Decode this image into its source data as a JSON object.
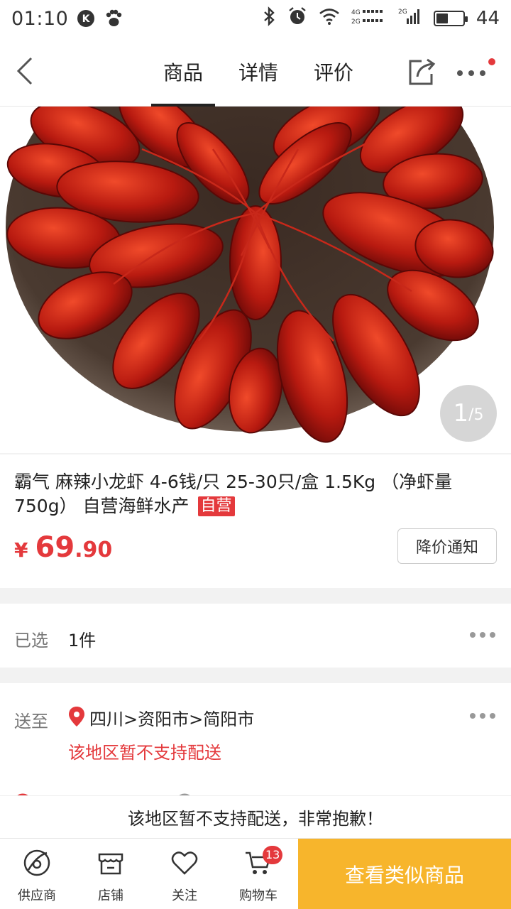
{
  "status_bar": {
    "time": "01:10",
    "battery": "44",
    "battery_level": 0.44,
    "icons": [
      "k-icon",
      "paw-icon",
      "bluetooth-icon",
      "alarm-icon",
      "wifi-icon",
      "signal-4g-icon",
      "signal-2g-icon",
      "battery-icon"
    ]
  },
  "nav": {
    "tabs": [
      {
        "label": "商品",
        "active": true
      },
      {
        "label": "详情",
        "active": false
      },
      {
        "label": "评价",
        "active": false
      }
    ]
  },
  "gallery": {
    "current": "1",
    "separator": "/",
    "total": "5"
  },
  "product": {
    "title": "霸气 麻辣小龙虾 4-6钱/只 25-30只/盒 1.5Kg （净虾量750g） 自营海鲜水产",
    "badge": "自营",
    "price_currency": "¥",
    "price_int": "69",
    "price_dec": ".90",
    "notify_label": "降价通知"
  },
  "selected": {
    "label": "已选",
    "value": "1件"
  },
  "delivery": {
    "label": "送至",
    "location": "四川>资阳市>简阳市",
    "warning": "该地区暂不支持配送"
  },
  "notice": "该地区暂不支持配送，非常抱歉！",
  "bottom_bar": {
    "items": [
      {
        "label": "供应商",
        "icon": "supplier-icon"
      },
      {
        "label": "店铺",
        "icon": "store-icon"
      },
      {
        "label": "关注",
        "icon": "heart-icon"
      },
      {
        "label": "购物车",
        "icon": "cart-icon",
        "badge": "13"
      }
    ],
    "primary_label": "查看类似商品"
  },
  "colors": {
    "accent": "#e4393c",
    "cta": "#f7b52c"
  }
}
